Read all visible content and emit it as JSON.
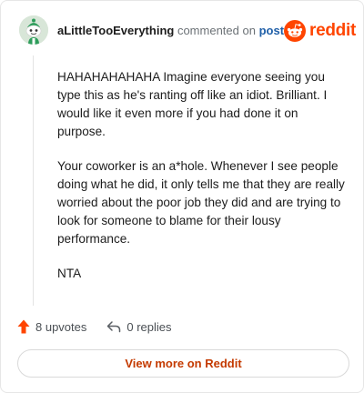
{
  "header": {
    "author": "aLittleTooEverything",
    "commented_on": "commented on",
    "post_link": "post",
    "brand": "reddit"
  },
  "comment": {
    "paragraphs": [
      "HAHAHAHAHAHA Imagine everyone seeing you type this as he's ranting off like an idiot. Brilliant. I would like it even more if you had done it on purpose.",
      "Your coworker is an a*hole. Whenever I see people doing what he did, it only tells me that they are really worried about the poor job they did and are trying to look for someone to blame for their lousy performance.",
      "NTA"
    ]
  },
  "footer": {
    "upvotes": "8 upvotes",
    "replies": "0 replies",
    "view_more": "View more on Reddit"
  },
  "colors": {
    "brand": "#ff4500",
    "link": "#1f5fa8",
    "button_text": "#c43a00"
  },
  "icons": {
    "avatar": "snoo-avatar",
    "logo": "reddit-snoo-icon",
    "upvote": "upvote-arrow-icon",
    "reply": "reply-arrow-icon"
  }
}
